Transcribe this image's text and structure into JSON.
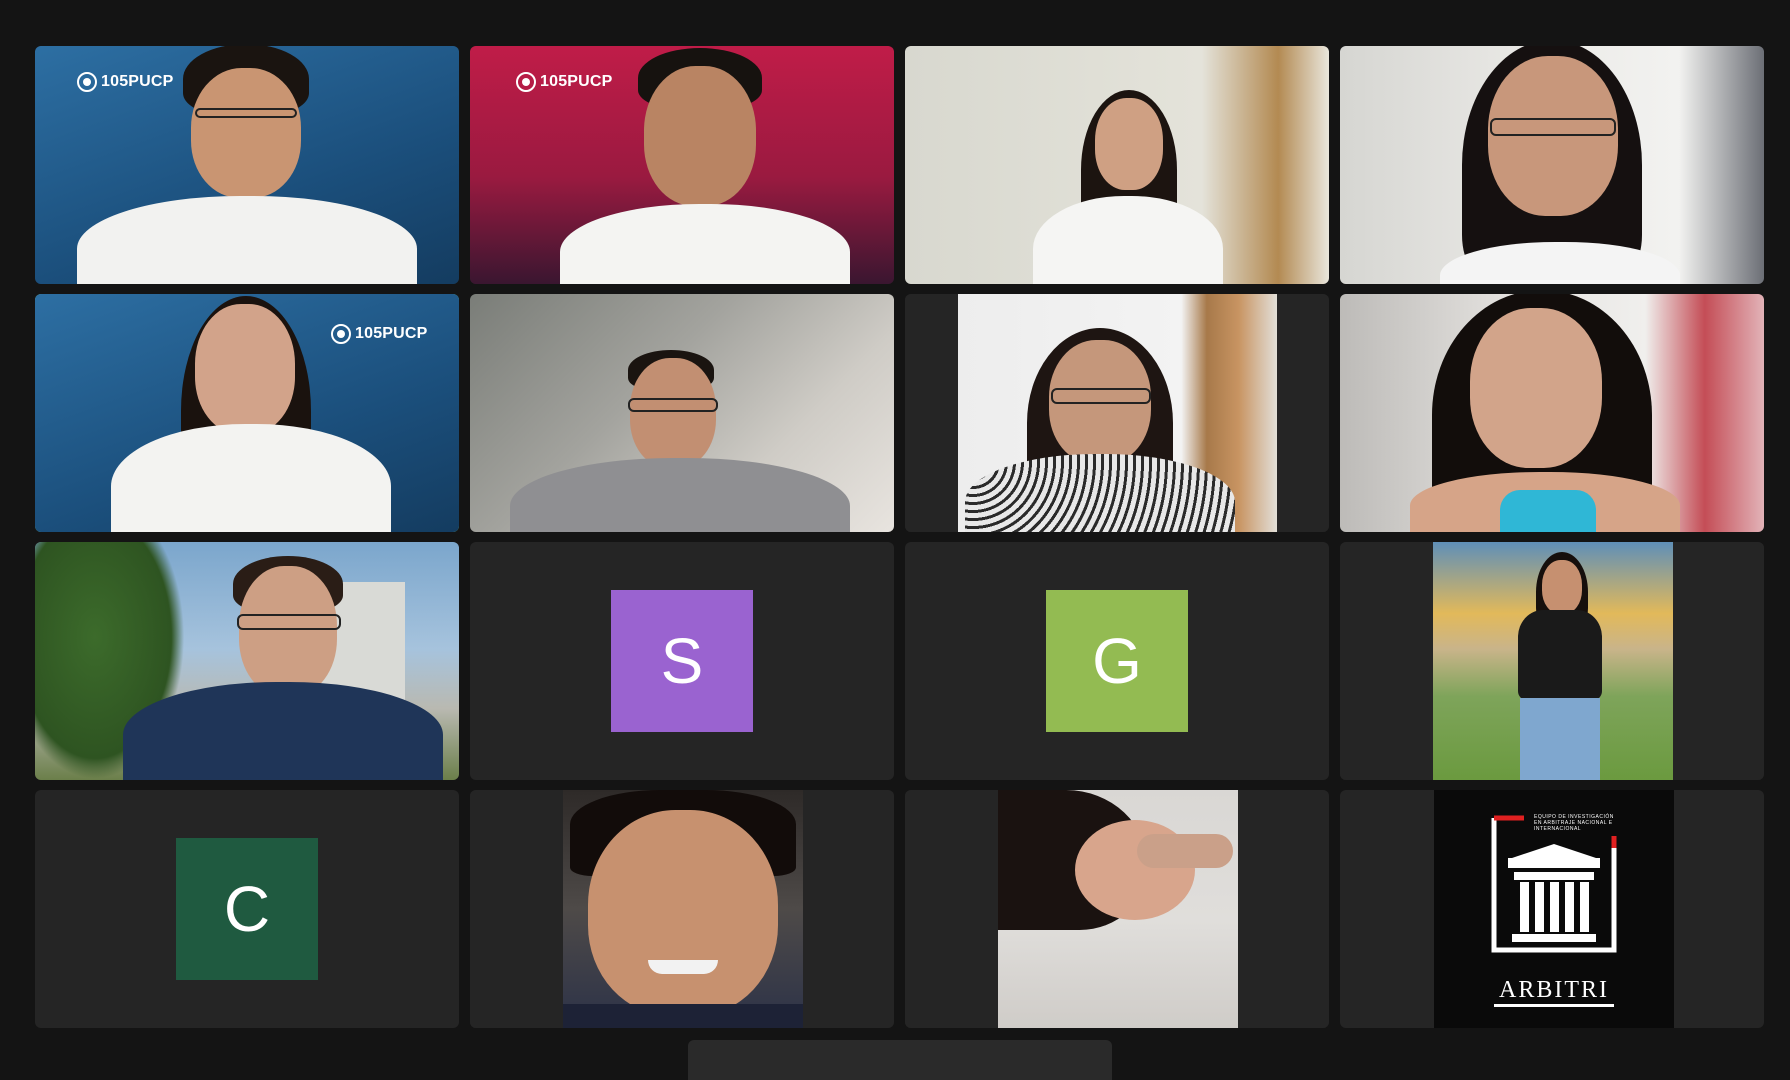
{
  "meeting": {
    "tiles": [
      {
        "kind": "video",
        "brand": "105PUCP",
        "bg": "#1f5f8f"
      },
      {
        "kind": "video",
        "brand": "105PUCP",
        "bg": "#a3183f"
      },
      {
        "kind": "video",
        "bg": "#dcdcd4"
      },
      {
        "kind": "video",
        "bg": "#e6e6e2"
      },
      {
        "kind": "video",
        "brand": "105PUCP",
        "bg": "#1f5f8f",
        "active_speaker": true
      },
      {
        "kind": "video",
        "bg": "#8a8a86"
      },
      {
        "kind": "video",
        "bg": "#ececec"
      },
      {
        "kind": "video",
        "bg": "#c8c4c2"
      },
      {
        "kind": "video",
        "bg": "#5f88ad"
      },
      {
        "kind": "avatar",
        "initial": "S",
        "color": "#9a63d0"
      },
      {
        "kind": "avatar",
        "initial": "G",
        "color": "#93bb52"
      },
      {
        "kind": "photo",
        "bg": "#5b8a4a"
      },
      {
        "kind": "avatar",
        "initial": "C",
        "color": "#1f5a40"
      },
      {
        "kind": "photo",
        "bg": "#3a2c22"
      },
      {
        "kind": "photo",
        "bg": "#d9d7d4"
      },
      {
        "kind": "logo",
        "logo_text": "ARBITRI",
        "logo_subtext": "EQUIPO DE INVESTIGACIÓN EN ARBITRAJE NACIONAL E INTERNACIONAL"
      }
    ]
  }
}
